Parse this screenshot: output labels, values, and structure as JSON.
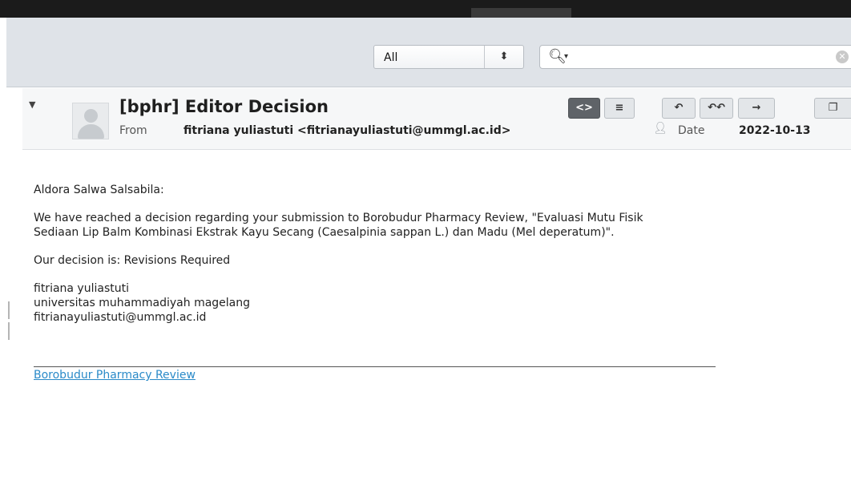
{
  "toolbar": {
    "filter_select": {
      "value": "All"
    },
    "search": {
      "value": ""
    }
  },
  "message": {
    "subject": "[bphr] Editor Decision",
    "from_label": "From",
    "from_value": "fitriana yuliastuti <fitrianayuliastuti@ummgl.ac.id>",
    "date_label": "Date",
    "date_value": "2022-10-13"
  },
  "body": {
    "greeting": "Aldora Salwa Salsabila:",
    "p1_line1": "We have reached a decision regarding your submission to Borobudur Pharmacy Review, \"Evaluasi Mutu Fisik",
    "p1_line2": "Sediaan Lip Balm Kombinasi Ekstrak Kayu Secang (Caesalpinia sappan L.) dan Madu (Mel deperatum)\".",
    "decision": "Our decision is: Revisions Required",
    "sig_name": "fitriana yuliastuti",
    "sig_org": "universitas muhammadiyah magelang",
    "sig_email": "fitrianayuliastuti@ummgl.ac.id",
    "footer_link": "Borobudur Pharmacy Review"
  },
  "icons": [
    "dropdown-arrows-icon",
    "search-icon",
    "clear-icon",
    "collapse-arrow-icon",
    "avatar-icon",
    "html-view-icon",
    "plain-text-icon",
    "reply-icon",
    "reply-all-icon",
    "forward-icon",
    "window-icon",
    "add-contact-icon",
    "resize-grip-icon"
  ]
}
